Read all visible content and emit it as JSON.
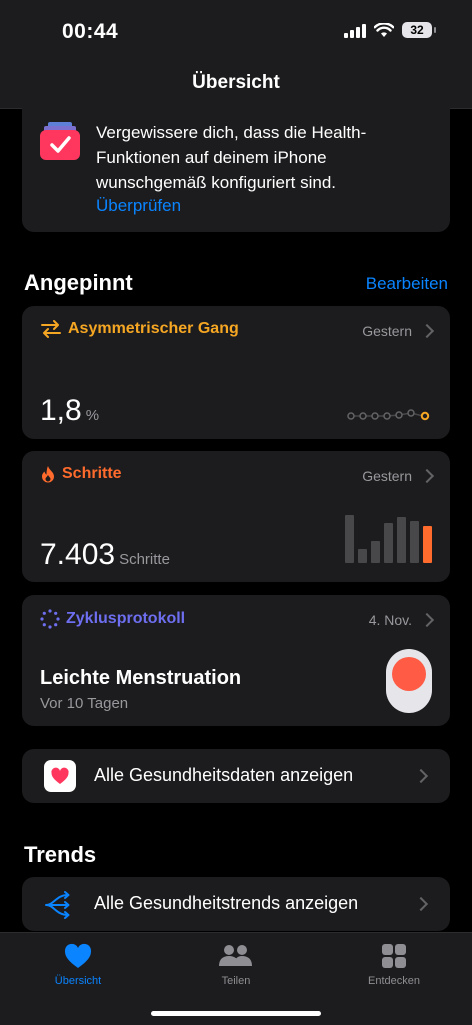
{
  "status": {
    "time": "00:44",
    "battery": "32"
  },
  "nav": {
    "title": "Übersicht"
  },
  "reminder": {
    "text": "Vergewissere dich, dass die Health-Funktionen auf deinem iPhone wunschgemäß konfiguriert sind.",
    "link": "Überprüfen"
  },
  "pinned": {
    "header": "Angepinnt",
    "edit": "Bearbeiten",
    "gait": {
      "title": "Asymmetrischer Gang",
      "date": "Gestern",
      "value": "1,8",
      "unit": "%"
    },
    "steps": {
      "title": "Schritte",
      "date": "Gestern",
      "value": "7.403",
      "unit": "Schritte"
    },
    "cycle": {
      "title": "Zyklusprotokoll",
      "date": "4. Nov.",
      "status": "Leichte Menstruation",
      "ago": "Vor 10 Tagen"
    }
  },
  "all_data": {
    "label": "Alle Gesundheitsdaten anzeigen"
  },
  "trends": {
    "header": "Trends",
    "label": "Alle Gesundheitstrends anzeigen"
  },
  "tabs": [
    {
      "label": "Übersicht",
      "icon": "heart-icon",
      "active": true
    },
    {
      "label": "Teilen",
      "icon": "people-icon",
      "active": false
    },
    {
      "label": "Entdecken",
      "icon": "grid-icon",
      "active": false
    }
  ],
  "colors": {
    "accent": "#0a84ff",
    "gait": "#f5a623",
    "steps": "#ff6b2c",
    "cycle": "#6e6ef0",
    "menstruation": "#ff5b45"
  }
}
